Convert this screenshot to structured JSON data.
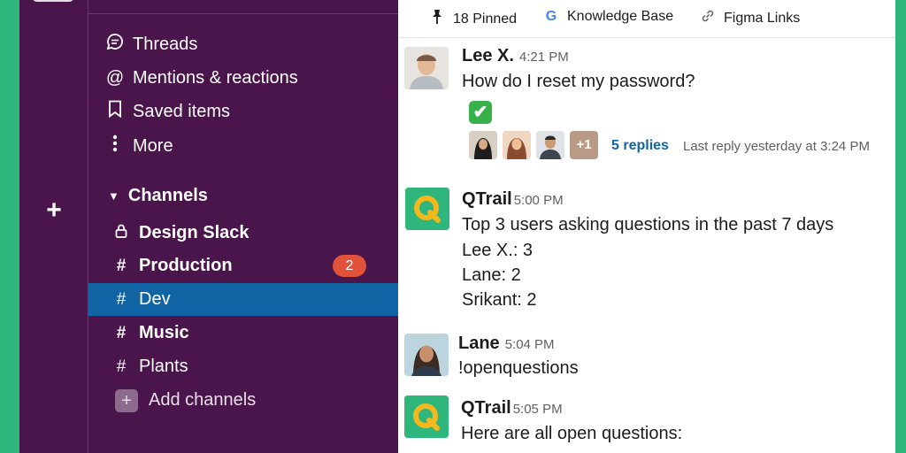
{
  "sidebar": {
    "nav": [
      {
        "label": "Threads",
        "icon": "threads-icon"
      },
      {
        "label": "Mentions & reactions",
        "icon": "at-icon"
      },
      {
        "label": "Saved items",
        "icon": "bookmark-icon"
      },
      {
        "label": "More",
        "icon": "more-vertical-icon"
      }
    ],
    "channels_header": "Channels",
    "channels": [
      {
        "prefix": "🔒",
        "label": "Design Slack"
      },
      {
        "prefix": "#",
        "label": "Production",
        "badge": "2"
      },
      {
        "prefix": "#",
        "label": "Dev"
      },
      {
        "prefix": "#",
        "label": "Music"
      },
      {
        "prefix": "#",
        "label": "Plants"
      }
    ],
    "add_channels": "Add channels"
  },
  "pinbar": {
    "pinned": "18 Pinned",
    "knowledge": "Knowledge Base",
    "figma": "Figma Links"
  },
  "messages": {
    "m1": {
      "author": "Lee X.",
      "time": "4:21 PM",
      "text": "How do I reset my password?",
      "reaction": "✔",
      "extra_count": "+1",
      "replies": "5 replies",
      "last_reply": "Last reply yesterday at 3:24 PM"
    },
    "m2": {
      "author": "QTrail",
      "time": "5:00 PM",
      "lines": [
        "Top 3 users asking questions in the past 7 days",
        "Lee X.: 3",
        "Lane: 2",
        "Srikant: 2"
      ]
    },
    "m3": {
      "author": "Lane",
      "time": "5:04 PM",
      "text": "!openquestions"
    },
    "m4": {
      "author": "QTrail",
      "time": "5:05 PM",
      "text": "Here are all open questions:"
    }
  },
  "colors": {
    "sidebar_bg": "#4a154b",
    "active_channel": "#1164a3",
    "badge": "#e0523a",
    "qtrail_brand": "#2eb67d",
    "link": "#1264a3"
  }
}
